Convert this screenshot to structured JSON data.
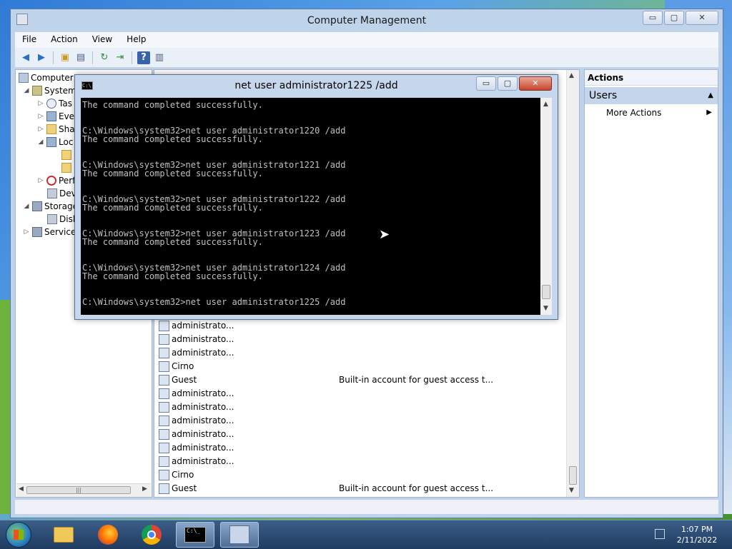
{
  "mmc": {
    "title": "Computer Management",
    "window_buttons": [
      "▭",
      "▢",
      "✕"
    ],
    "menu": [
      "File",
      "Action",
      "View",
      "Help"
    ],
    "tree": [
      {
        "label": "Computer Management (Local)",
        "display": "Computer M"
      },
      {
        "label": "System Tools",
        "display": "System"
      },
      {
        "label": "Task Scheduler",
        "display": "Tas"
      },
      {
        "label": "Event Viewer",
        "display": "Eve"
      },
      {
        "label": "Shared Folders",
        "display": "Sha"
      },
      {
        "label": "Local Users and Groups",
        "display": "Loc"
      },
      {
        "label": "",
        "display": ""
      },
      {
        "label": "",
        "display": ""
      },
      {
        "label": "Performance",
        "display": "Perf"
      },
      {
        "label": "Device Manager",
        "display": "Dev"
      },
      {
        "label": "Storage",
        "display": "Storage"
      },
      {
        "label": "Disk Management",
        "display": "Disk"
      },
      {
        "label": "Services and Applications",
        "display": "Service"
      }
    ],
    "list_rows": [
      {
        "name": "administrato...",
        "desc": ""
      },
      {
        "name": "administrato...",
        "desc": ""
      },
      {
        "name": "administrato...",
        "desc": ""
      },
      {
        "name": "Cirno",
        "desc": ""
      },
      {
        "name": "Guest",
        "desc": "Built-in account for guest access t..."
      },
      {
        "name": "administrato...",
        "desc": ""
      },
      {
        "name": "administrato...",
        "desc": ""
      },
      {
        "name": "administrato...",
        "desc": ""
      },
      {
        "name": "administrato...",
        "desc": ""
      },
      {
        "name": "administrato...",
        "desc": ""
      },
      {
        "name": "administrato...",
        "desc": ""
      },
      {
        "name": "Cirno",
        "desc": ""
      },
      {
        "name": "Guest",
        "desc": "Built-in account for guest access t..."
      }
    ],
    "actions": {
      "header": "Actions",
      "section": "Users",
      "more": "More Actions"
    }
  },
  "cmd": {
    "title": "net  user administrator1225 /add",
    "lines": [
      "The command completed successfully.",
      "",
      "",
      "C:\\Windows\\system32>net user administrator1220 /add",
      "The command completed successfully.",
      "",
      "",
      "C:\\Windows\\system32>net user administrator1221 /add",
      "The command completed successfully.",
      "",
      "",
      "C:\\Windows\\system32>net user administrator1222 /add",
      "The command completed successfully.",
      "",
      "",
      "C:\\Windows\\system32>net user administrator1223 /add",
      "The command completed successfully.",
      "",
      "",
      "C:\\Windows\\system32>net user administrator1224 /add",
      "The command completed successfully.",
      "",
      "",
      "C:\\Windows\\system32>net user administrator1225 /add"
    ]
  },
  "taskbar": {
    "time": "1:07 PM",
    "date": "2/11/2022"
  }
}
